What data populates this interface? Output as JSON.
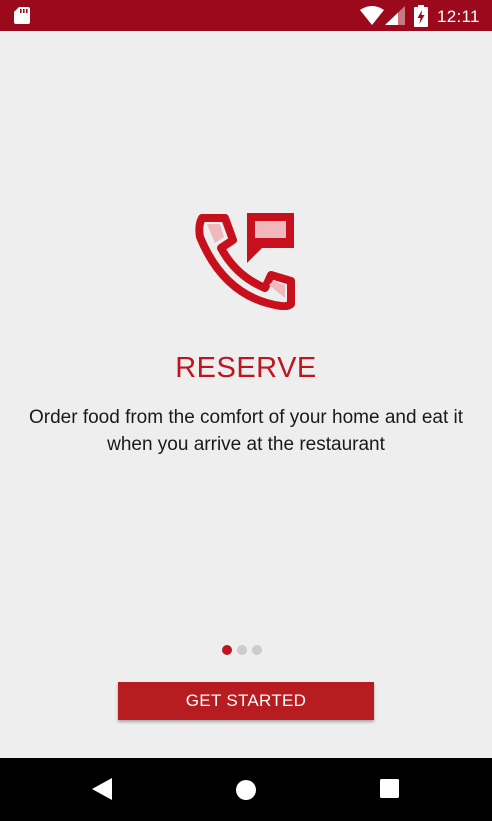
{
  "status_bar": {
    "time": "12:11",
    "icons": [
      "sd-card-icon",
      "wifi-icon",
      "signal-icon",
      "battery-charging-icon"
    ],
    "background_color": "#9b0a1c"
  },
  "slide": {
    "icon": "phone-chat-icon",
    "title": "RESERVE",
    "description": "Order food from the comfort of your home and eat it when you arrive at the restaurant",
    "accent_color": "#c0141f"
  },
  "pager": {
    "total": 3,
    "active_index": 0
  },
  "cta": {
    "label": "GET STARTED",
    "color": "#b61c20"
  },
  "nav_bar": {
    "icons": [
      "back-icon",
      "home-icon",
      "recents-icon"
    ]
  }
}
